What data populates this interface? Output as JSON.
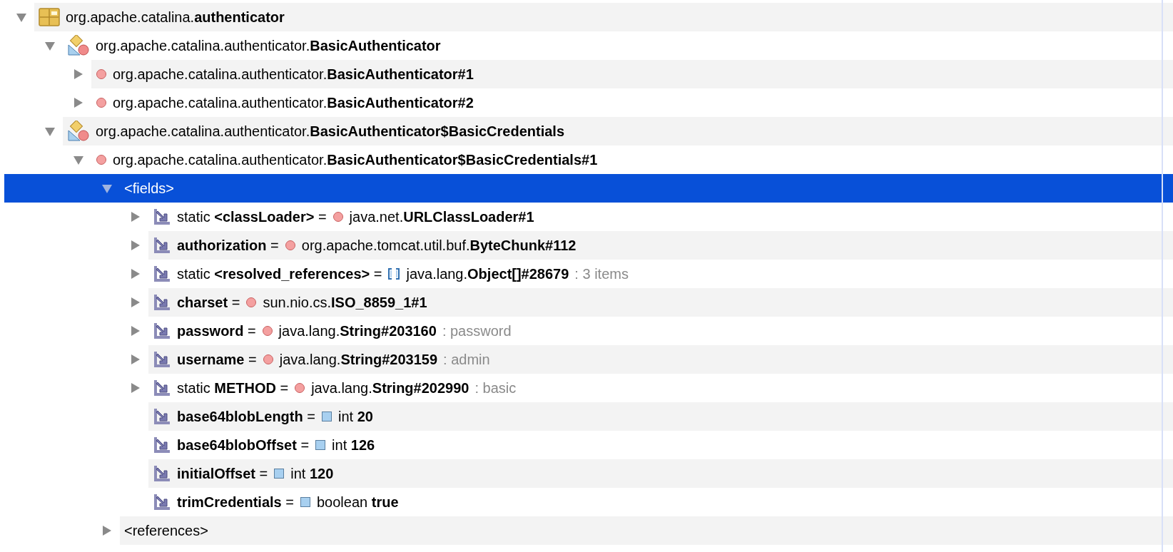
{
  "tree": [
    {
      "kind": "package",
      "label": "org.apache.catalina.**authenticator**",
      "expandable": true,
      "expanded": true,
      "selected": false,
      "children": [
        {
          "kind": "class",
          "label": "org.apache.catalina.authenticator.**BasicAuthenticator**",
          "expandable": true,
          "expanded": true,
          "selected": false,
          "children": [
            {
              "kind": "instance",
              "label": "org.apache.catalina.authenticator.**BasicAuthenticator#1**",
              "expandable": true,
              "expanded": false,
              "selected": false
            },
            {
              "kind": "instance",
              "label": "org.apache.catalina.authenticator.**BasicAuthenticator#2**",
              "expandable": true,
              "expanded": false,
              "selected": false
            }
          ]
        },
        {
          "kind": "class",
          "label": "org.apache.catalina.authenticator.**BasicAuthenticator$BasicCredentials**",
          "expandable": true,
          "expanded": true,
          "selected": false,
          "children": [
            {
              "kind": "instance",
              "label": "org.apache.catalina.authenticator.**BasicAuthenticator$BasicCredentials#1**",
              "expandable": true,
              "expanded": true,
              "selected": false,
              "children": [
                {
                  "kind": "group",
                  "label": "<fields>",
                  "expandable": true,
                  "expanded": true,
                  "selected": true,
                  "children": [
                    {
                      "kind": "object_field",
                      "name": "static **<classLoader>** =",
                      "value": "java.net.**URLClassLoader#1**",
                      "expandable": true,
                      "expanded": false,
                      "selected": false
                    },
                    {
                      "kind": "object_field",
                      "name": "**authorization** =",
                      "value": "org.apache.tomcat.util.buf.**ByteChunk#112**",
                      "expandable": true,
                      "expanded": false,
                      "selected": false
                    },
                    {
                      "kind": "array_field",
                      "name": "static **<resolved_references>** =",
                      "value": "java.lang.**Object[]#28679**",
                      "note": ": 3 items",
                      "expandable": true,
                      "expanded": false,
                      "selected": false
                    },
                    {
                      "kind": "object_field",
                      "name": "**charset** =",
                      "value": "sun.nio.cs.**ISO_8859_1#1**",
                      "expandable": true,
                      "expanded": false,
                      "selected": false
                    },
                    {
                      "kind": "object_field",
                      "name": "**password** =",
                      "value": "java.lang.**String#203160**",
                      "note": ": password",
                      "expandable": true,
                      "expanded": false,
                      "selected": false
                    },
                    {
                      "kind": "object_field",
                      "name": "**username** =",
                      "value": "java.lang.**String#203159**",
                      "note": ": admin",
                      "expandable": true,
                      "expanded": false,
                      "selected": false
                    },
                    {
                      "kind": "object_field",
                      "name": "static **METHOD** =",
                      "value": "java.lang.**String#202990**",
                      "note": ": basic",
                      "expandable": true,
                      "expanded": false,
                      "selected": false
                    },
                    {
                      "kind": "primitive_field",
                      "name": "**base64blobLength** =",
                      "value": "int **20**",
                      "expandable": false,
                      "selected": false
                    },
                    {
                      "kind": "primitive_field",
                      "name": "**base64blobOffset** =",
                      "value": "int **126**",
                      "expandable": false,
                      "selected": false
                    },
                    {
                      "kind": "primitive_field",
                      "name": "**initialOffset** =",
                      "value": "int **120**",
                      "expandable": false,
                      "selected": false
                    },
                    {
                      "kind": "primitive_field",
                      "name": "**trimCredentials** =",
                      "value": "boolean **true**",
                      "expandable": false,
                      "selected": false
                    }
                  ]
                },
                {
                  "kind": "group",
                  "label": "<references>",
                  "expandable": true,
                  "expanded": false,
                  "selected": false
                }
              ]
            }
          ]
        }
      ]
    }
  ]
}
